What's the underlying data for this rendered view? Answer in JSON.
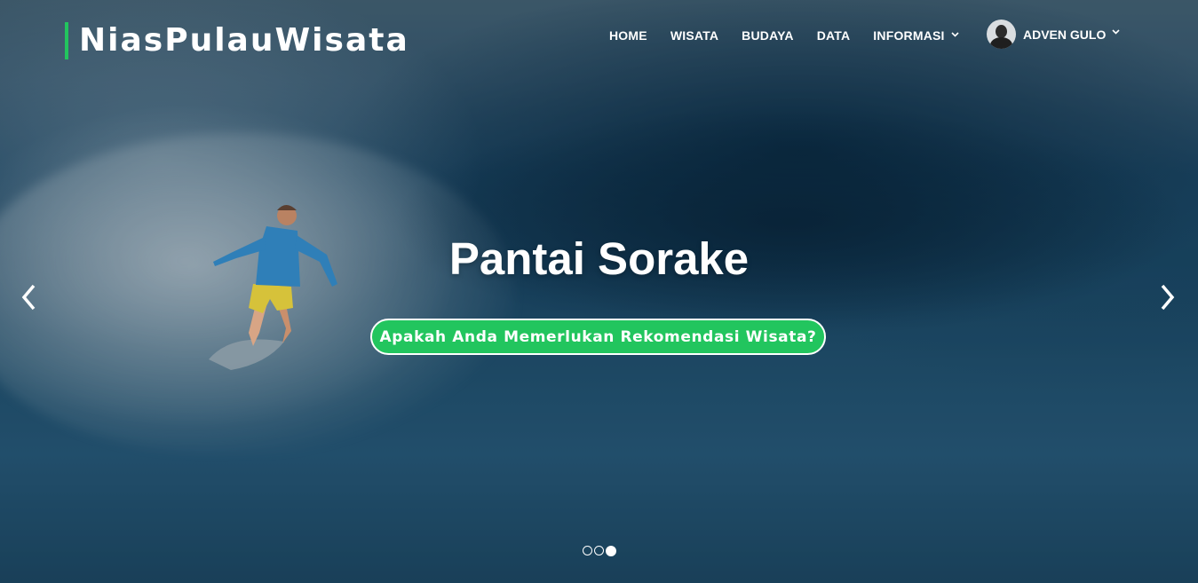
{
  "header": {
    "brand": "NiasPulauWisata",
    "accent_color": "#22c55e",
    "nav": [
      {
        "label": "HOME"
      },
      {
        "label": "WISATA"
      },
      {
        "label": "BUDAYA"
      },
      {
        "label": "DATA"
      },
      {
        "label": "INFORMASI",
        "icon": "chevron-down-icon"
      }
    ],
    "user": {
      "name": "ADVEN GULO",
      "icon": "chevron-down-icon"
    }
  },
  "hero": {
    "title": "Pantai Sorake",
    "cta_label": "Apakah Anda Memerlukan Rekomendasi Wisata?",
    "prev_icon": "chevron-left-icon",
    "next_icon": "chevron-right-icon",
    "slide_count": 3,
    "active_slide": 3
  }
}
